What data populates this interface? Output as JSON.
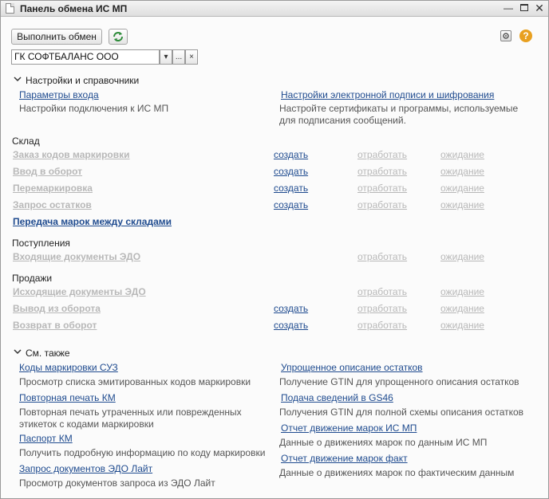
{
  "window": {
    "title": "Панель обмена ИС МП"
  },
  "toolbar": {
    "exchange_label": "Выполнить обмен",
    "org_value": "ГК СОФТБАЛАНС ООО",
    "dropdown_glyph": "▾",
    "open_glyph": "...",
    "clear_glyph": "×"
  },
  "settings": {
    "group_label": "Настройки и справочники",
    "left_link": "Параметры входа",
    "left_desc": "Настройки подключения к ИС МП",
    "right_link": "Настройки электронной подписи и шифрования",
    "right_desc": "Настройте сертификаты и программы, используемые для подписания сообщений."
  },
  "warehouse": {
    "label": "Склад",
    "rows": [
      {
        "name": "Заказ кодов маркировки",
        "create": "создать",
        "process": "отработать",
        "wait": "ожидание"
      },
      {
        "name": "Ввод в оборот",
        "create": "создать",
        "process": "отработать",
        "wait": "ожидание"
      },
      {
        "name": "Перемаркировка",
        "create": "создать",
        "process": "отработать",
        "wait": "ожидание"
      },
      {
        "name": "Запрос остатков",
        "create": "создать",
        "process": "отработать",
        "wait": "ожидание"
      }
    ],
    "transfer": "Передача марок между складами"
  },
  "receipts": {
    "label": "Поступления",
    "rows": [
      {
        "name": "Входящие документы ЭДО",
        "process": "отработать",
        "wait": "ожидание"
      }
    ]
  },
  "sales": {
    "label": "Продажи",
    "rows": [
      {
        "name": "Исходящие документы ЭДО",
        "process": "отработать",
        "wait": "ожидание"
      },
      {
        "name": "Вывод из оборота",
        "create": "создать",
        "process": "отработать",
        "wait": "ожидание"
      },
      {
        "name": "Возврат в оборот",
        "create": "создать",
        "process": "отработать",
        "wait": "ожидание"
      }
    ]
  },
  "see_also": {
    "group_label": "См. также",
    "left": [
      {
        "link": "Коды маркировки СУЗ",
        "desc": "Просмотр списка эмитированных кодов маркировки"
      },
      {
        "link": "Повторная печать КМ",
        "desc": "Повторная печать утраченных или поврежденных этикеток с кодами маркировки"
      },
      {
        "link": "Паспорт КМ",
        "desc": "Получить подробную информацию по коду маркировки"
      },
      {
        "link": "Запрос документов ЭДО Лайт",
        "desc": "Просмотр документов запроса из ЭДО Лайт"
      }
    ],
    "right": [
      {
        "link": "Упрощенное описание остатков",
        "desc": "Получение GTIN для упрощенного описания остатков"
      },
      {
        "link": "Подача сведений в GS46",
        "desc": "Получения GTIN для полной схемы описания остатков"
      },
      {
        "link": "Отчет движение марок ИС МП",
        "desc": "Данные о движениях марок по данным ИС МП"
      },
      {
        "link": "Отчет движение марок факт",
        "desc": "Данные о движениях марок по фактическим данным"
      }
    ]
  },
  "colors": {
    "link": "#1f4b8f",
    "disabled": "#b8b8b8",
    "accent_green": "#2e8b3a",
    "help_orange": "#e8a020"
  }
}
